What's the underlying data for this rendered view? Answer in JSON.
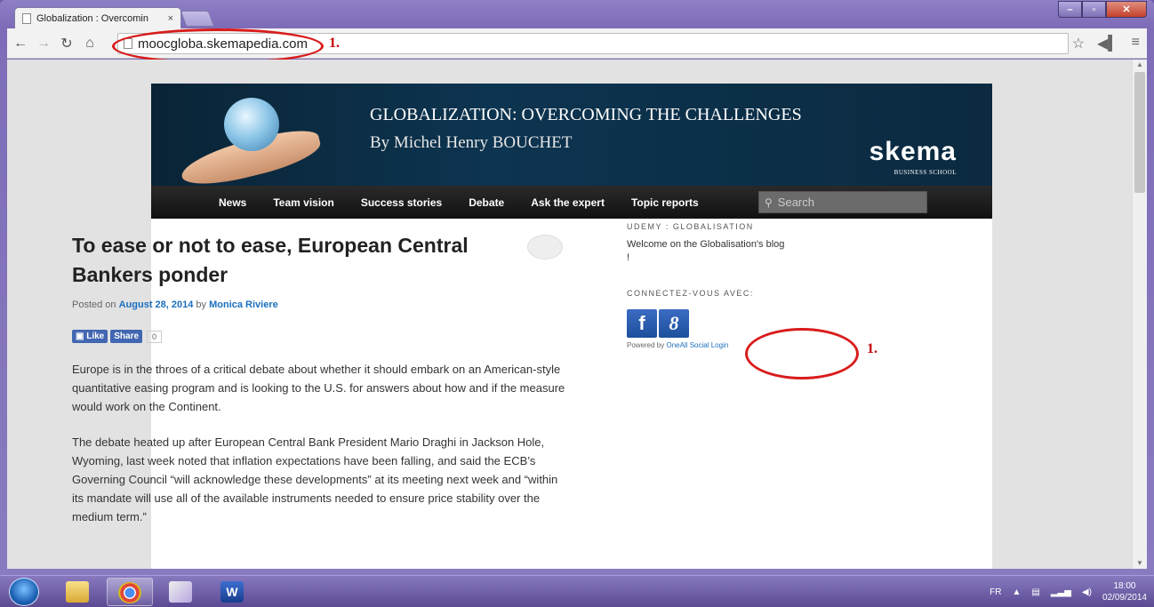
{
  "browser": {
    "tab_title": "Globalization : Overcomin",
    "tab_close": "×",
    "url": "moocgloba.skemapedia.com",
    "annotation_label": "1."
  },
  "site": {
    "title": "GLOBALIZATION: OVERCOMING THE CHALLENGES",
    "subtitle": "By Michel Henry BOUCHET",
    "logo": "skema",
    "logo_sub": "BUSINESS SCHOOL",
    "nav": [
      "News",
      "Team vision",
      "Success stories",
      "Debate",
      "Ask the expert",
      "Topic reports"
    ],
    "search_placeholder": "Search"
  },
  "post": {
    "title": "To ease or not to ease, European Central Bankers ponder",
    "posted_on": "Posted on ",
    "date": "August 28, 2014",
    "by": " by ",
    "author": "Monica Riviere",
    "like": "Like",
    "share": "Share",
    "share_count": "0",
    "paragraphs": [
      "Europe is in the throes of a critical debate about whether it should embark on an American-style quantitative easing program and is looking to the U.S. for answers about how and if the measure would work on the Continent.",
      "The debate heated up after European Central Bank President Mario Draghi in Jackson Hole, Wyoming, last week noted that inflation expectations have been falling, and said the ECB’s Governing Council “will acknowledge these developments” at its meeting next week and “within its mandate will use all of the available instruments needed to ensure price stability over the medium term.”"
    ]
  },
  "sidebar": {
    "widget_title": "UDEMY : GLOBALISATION",
    "widget_text": "Welcome on the Globalisation's blog !",
    "connect_title": "CONNECTEZ-VOUS AVEC:",
    "fb_letter": "f",
    "google_letter": "8",
    "powered_prefix": "Powered by ",
    "powered_link": "OneAll Social Login",
    "annotation_label": "1."
  },
  "taskbar": {
    "lang": "FR",
    "time": "18:00",
    "date": "02/09/2014"
  },
  "icons": [
    "back-icon",
    "forward-icon",
    "reload-icon",
    "home-icon",
    "page-icon",
    "star-icon",
    "speaker-icon",
    "menu-icon"
  ]
}
